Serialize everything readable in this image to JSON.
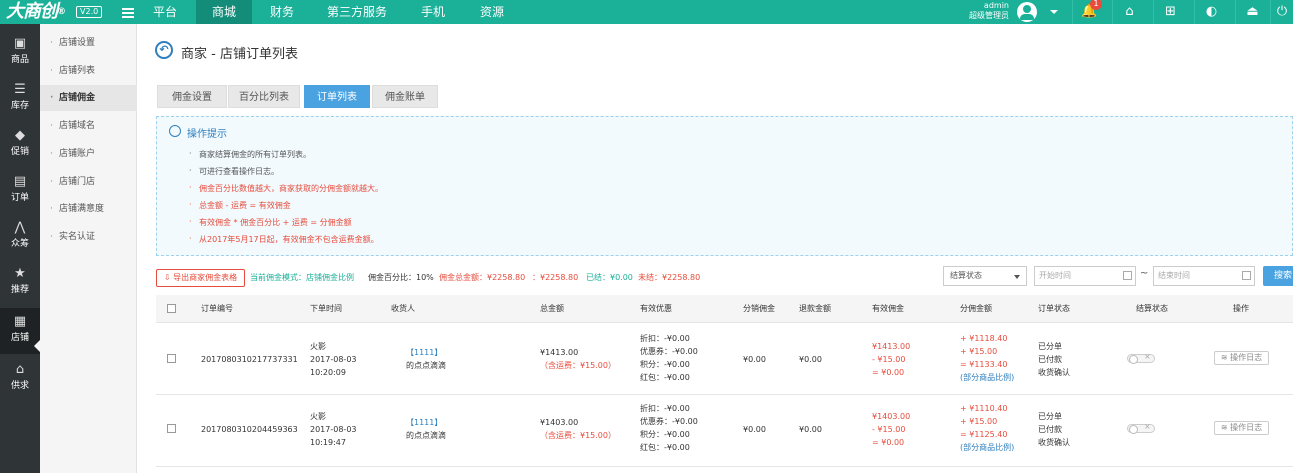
{
  "topbar": {
    "logo": "大商创",
    "logo_mark": "®",
    "version": "V2.0",
    "nav": [
      "平台",
      "商城",
      "财务",
      "第三方服务",
      "手机",
      "资源"
    ],
    "user_name": "admin",
    "user_role": "超级管理员",
    "notification_count": "1",
    "accent_color": "#1bb098"
  },
  "leftbar": {
    "items": [
      {
        "label": "商品",
        "icon": "bag-icon"
      },
      {
        "label": "库存",
        "icon": "stack-icon"
      },
      {
        "label": "促销",
        "icon": "tag-icon"
      },
      {
        "label": "订单",
        "icon": "document-icon"
      },
      {
        "label": "众筹",
        "icon": "chart-icon"
      },
      {
        "label": "推荐",
        "icon": "star-icon"
      },
      {
        "label": "店铺",
        "icon": "store-icon"
      },
      {
        "label": "供求",
        "icon": "home-icon"
      }
    ]
  },
  "submenu": {
    "items": [
      "店铺设置",
      "店铺列表",
      "店铺佣金",
      "店铺域名",
      "店铺账户",
      "店铺门店",
      "店铺满意度",
      "实名认证"
    ]
  },
  "page": {
    "title": "商家 - 店铺订单列表",
    "tabs": [
      "佣金设置",
      "百分比列表",
      "订单列表",
      "佣金账单"
    ]
  },
  "tips": {
    "title": "操作提示",
    "items": [
      "商家结算佣金的所有订单列表。",
      "可进行查看操作日志。",
      "佣金百分比数值越大，商家获取的分佣金额就越大。",
      "总金额 - 运费 = 有效佣金",
      "有效佣金 * 佣金百分比 + 运费 = 分佣金额",
      "从2017年5月17日起，有效佣金不包含运费金额。"
    ]
  },
  "toolbar": {
    "export_label": "导出商家佣金表格",
    "mode": "当前佣金模式：店铺佣金比例",
    "percent": "佣金百分比：10%",
    "total": "佣金总金额：¥2258.80",
    "total2": "：¥2258.80",
    "settled": "已结：¥0.00",
    "unsettled": "未结：¥2258.80",
    "status_select": "结算状态",
    "start_placeholder": "开始时间",
    "end_placeholder": "结束时间",
    "tilde": "~",
    "search_label": "搜索"
  },
  "table": {
    "headers": [
      "订单编号",
      "下单时间",
      "收货人",
      "总金额",
      "有效优惠",
      "分销佣金",
      "退款金额",
      "有效佣金",
      "分佣金额",
      "订单状态",
      "结算状态",
      "操作"
    ],
    "rows": [
      {
        "order_no": "2017080310217737331",
        "time_user": "火影",
        "date": "2017-08-03",
        "time": "10:20:09",
        "consignee_tag": "【1111】",
        "consignee": "的点点滴滴",
        "total": "¥1413.00",
        "shipping": "（含运费：¥15.00）",
        "discount": [
          "折扣：-¥0.00",
          "优惠券：-¥0.00",
          "积分：-¥0.00",
          "红包：-¥0.00"
        ],
        "distrib": "¥0.00",
        "refund": "¥0.00",
        "effective": [
          "¥1413.00",
          "- ¥15.00",
          "= ¥0.00"
        ],
        "split": [
          "+ ¥1118.40",
          "+ ¥15.00",
          "= ¥1133.40"
        ],
        "split_note": "(部分商品比例)",
        "status": [
          "已分单",
          "已付款",
          "收货确认"
        ],
        "log_label": "操作日志"
      },
      {
        "order_no": "2017080310204459363",
        "time_user": "火影",
        "date": "2017-08-03",
        "time": "10:19:47",
        "consignee_tag": "【1111】",
        "consignee": "的点点滴滴",
        "total": "¥1403.00",
        "shipping": "（含运费：¥15.00）",
        "discount": [
          "折扣：-¥0.00",
          "优惠券：-¥0.00",
          "积分：-¥0.00",
          "红包：-¥0.00"
        ],
        "distrib": "¥0.00",
        "refund": "¥0.00",
        "effective": [
          "¥1403.00",
          "- ¥15.00",
          "= ¥0.00"
        ],
        "split": [
          "+ ¥1110.40",
          "+ ¥15.00",
          "= ¥1125.40"
        ],
        "split_note": "(部分商品比例)",
        "status": [
          "已分单",
          "已付款",
          "收货确认"
        ],
        "log_label": "操作日志"
      }
    ]
  }
}
